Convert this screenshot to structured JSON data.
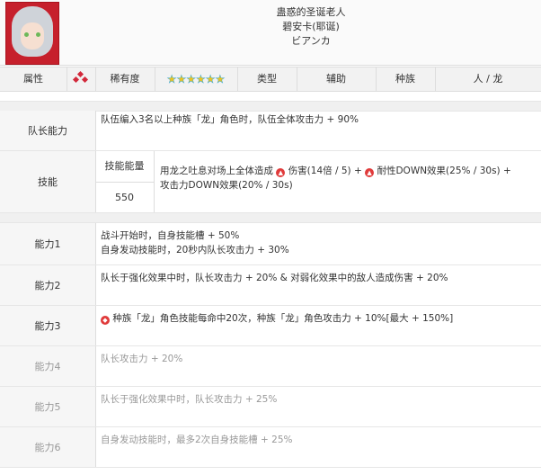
{
  "header": {
    "title1": "蛊惑的圣诞老人",
    "title2": "碧安卡(耶诞)",
    "title3": "ビアンカ"
  },
  "attrbar": {
    "attr_label": "属性",
    "rarity_label": "稀有度",
    "rarity_stars": 6,
    "type_label": "类型",
    "type_value": "辅助",
    "race_label": "种族",
    "race_value": "人 / 龙"
  },
  "leader": {
    "label": "队长能力",
    "text": "队伍编入3名以上种族「龙」角色时，队伍全体攻击力 + 90%"
  },
  "skill": {
    "label": "技能",
    "energy_label": "技能能量",
    "energy_value": "550",
    "line1_prefix": "用龙之吐息对场上全体造成",
    "line1_mid": "伤害(14倍 / 5) +",
    "line1_end": "耐性DOWN效果(25% / 30s) +",
    "line2": "攻击力DOWN效果(20% / 30s)"
  },
  "abilities": [
    {
      "label": "能力1",
      "line1": "战斗开始时，自身技能槽 + 50%",
      "line2": "自身发动技能时，20秒内队长攻击力 + 30%"
    },
    {
      "label": "能力2",
      "line1": "队长于强化效果中时，队长攻击力 + 20% & 对弱化效果中的敌人造成伤害 + 20%"
    },
    {
      "label": "能力3",
      "line1": "种族「龙」角色技能每命中20次，种族「龙」角色攻击力 + 10%[最大 + 150%]"
    },
    {
      "label": "能力4",
      "line1": "队长攻击力 + 20%"
    },
    {
      "label": "能力5",
      "line1": "队长于强化效果中时，队长攻击力 + 25%"
    },
    {
      "label": "能力6",
      "line1": "自身发动技能时，最多2次自身技能槽 + 25%"
    }
  ],
  "colors": {
    "accent": "#d2283a",
    "star": "#f0c419"
  }
}
